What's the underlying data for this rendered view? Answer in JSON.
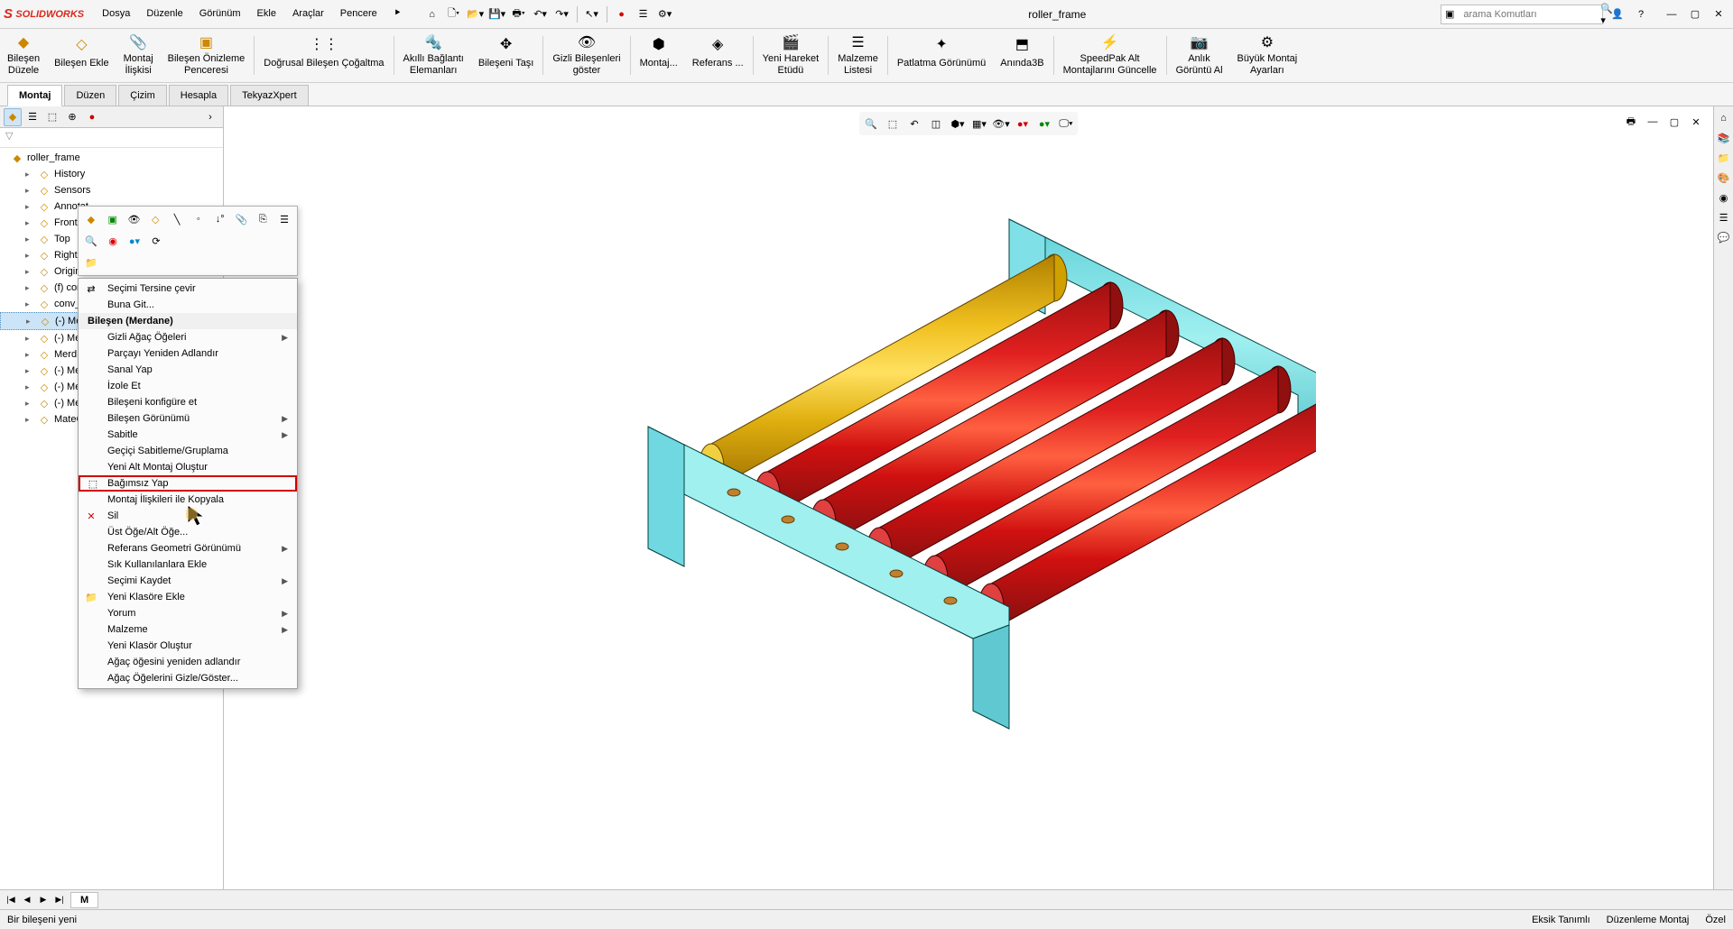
{
  "app": {
    "name": "SOLIDWORKS",
    "doc_title": "roller_frame"
  },
  "menu": [
    "Dosya",
    "Düzenle",
    "Görünüm",
    "Ekle",
    "Araçlar",
    "Pencere"
  ],
  "search": {
    "placeholder": "arama Komutları"
  },
  "ribbon": [
    {
      "label": "Bileşen\nDüzele"
    },
    {
      "label": "Bileşen Ekle"
    },
    {
      "label": "Montaj\nİlişkisi"
    },
    {
      "label": "Bileşen Önizleme\nPenceresi"
    },
    {
      "label": "Doğrusal Bileşen Çoğaltma"
    },
    {
      "label": "Akıllı Bağlantı\nElemanları"
    },
    {
      "label": "Bileşeni Taşı"
    },
    {
      "label": "Gizli Bileşenleri\ngöster"
    },
    {
      "label": "Montaj..."
    },
    {
      "label": "Referans ..."
    },
    {
      "label": "Yeni Hareket\nEtüdü"
    },
    {
      "label": "Malzeme\nListesi"
    },
    {
      "label": "Patlatma Görünümü"
    },
    {
      "label": "Anında3B"
    },
    {
      "label": "SpeedPak Alt\nMontajlarını Güncelle"
    },
    {
      "label": "Anlık\nGörüntü Al"
    },
    {
      "label": "Büyük Montaj\nAyarları"
    }
  ],
  "tabs": [
    "Montaj",
    "Düzen",
    "Çizim",
    "Hesapla",
    "TekyazXpert"
  ],
  "tree": {
    "root": "roller_frame",
    "items": [
      {
        "label": "History"
      },
      {
        "label": "Sensors"
      },
      {
        "label": "Annotat"
      },
      {
        "label": "Front"
      },
      {
        "label": "Top"
      },
      {
        "label": "Right"
      },
      {
        "label": "Origin"
      },
      {
        "label": "(f) conv_..."
      },
      {
        "label": "conv_rig"
      },
      {
        "label": "(-) Merd",
        "selected": true
      },
      {
        "label": "(-) Merd"
      },
      {
        "label": "Merd"
      },
      {
        "label": "(-) Merd"
      },
      {
        "label": "(-) Merd"
      },
      {
        "label": "(-) Merd"
      },
      {
        "label": "MateGro"
      }
    ]
  },
  "context": {
    "header": "Bileşen (Merdane)",
    "top": [
      {
        "label": "Seçimi Tersine çevir"
      },
      {
        "label": "Buna Git..."
      }
    ],
    "items": [
      {
        "label": "Gizli Ağaç Öğeleri",
        "sub": true
      },
      {
        "label": "Parçayı Yeniden Adlandır"
      },
      {
        "label": "Sanal Yap"
      },
      {
        "label": "İzole Et"
      },
      {
        "label": "Bileşeni konfigüre et"
      },
      {
        "label": "Bileşen Görünümü",
        "sub": true
      },
      {
        "label": "Sabitle",
        "sub": true
      },
      {
        "label": "Geçiçi Sabitleme/Gruplama"
      },
      {
        "label": "Yeni Alt Montaj Oluştur"
      },
      {
        "label": "Bağımsız Yap",
        "hl": true
      },
      {
        "label": "Montaj İlişkileri ile Kopyala"
      },
      {
        "label": "Sil",
        "icon": "x"
      },
      {
        "label": "Üst Öğe/Alt Öğe..."
      },
      {
        "label": "Referans Geometri Görünümü",
        "sub": true
      },
      {
        "label": "Sık Kullanılanlara Ekle"
      },
      {
        "label": "Seçimi Kaydet",
        "sub": true
      },
      {
        "label": "Yeni Klasöre Ekle",
        "icon": "folder"
      },
      {
        "label": "Yorum",
        "sub": true
      },
      {
        "label": "Malzeme",
        "sub": true
      },
      {
        "label": "Yeni Klasör Oluştur"
      },
      {
        "label": "Ağaç öğesini yeniden adlandır"
      },
      {
        "label": "Ağaç Öğelerini Gizle/Göster..."
      }
    ]
  },
  "status": {
    "left": "Bir bileşeni yeni",
    "r1": "Eksik Tanımlı",
    "r2": "Düzenleme Montaj",
    "r3": "Özel"
  },
  "doc_tab": "M"
}
